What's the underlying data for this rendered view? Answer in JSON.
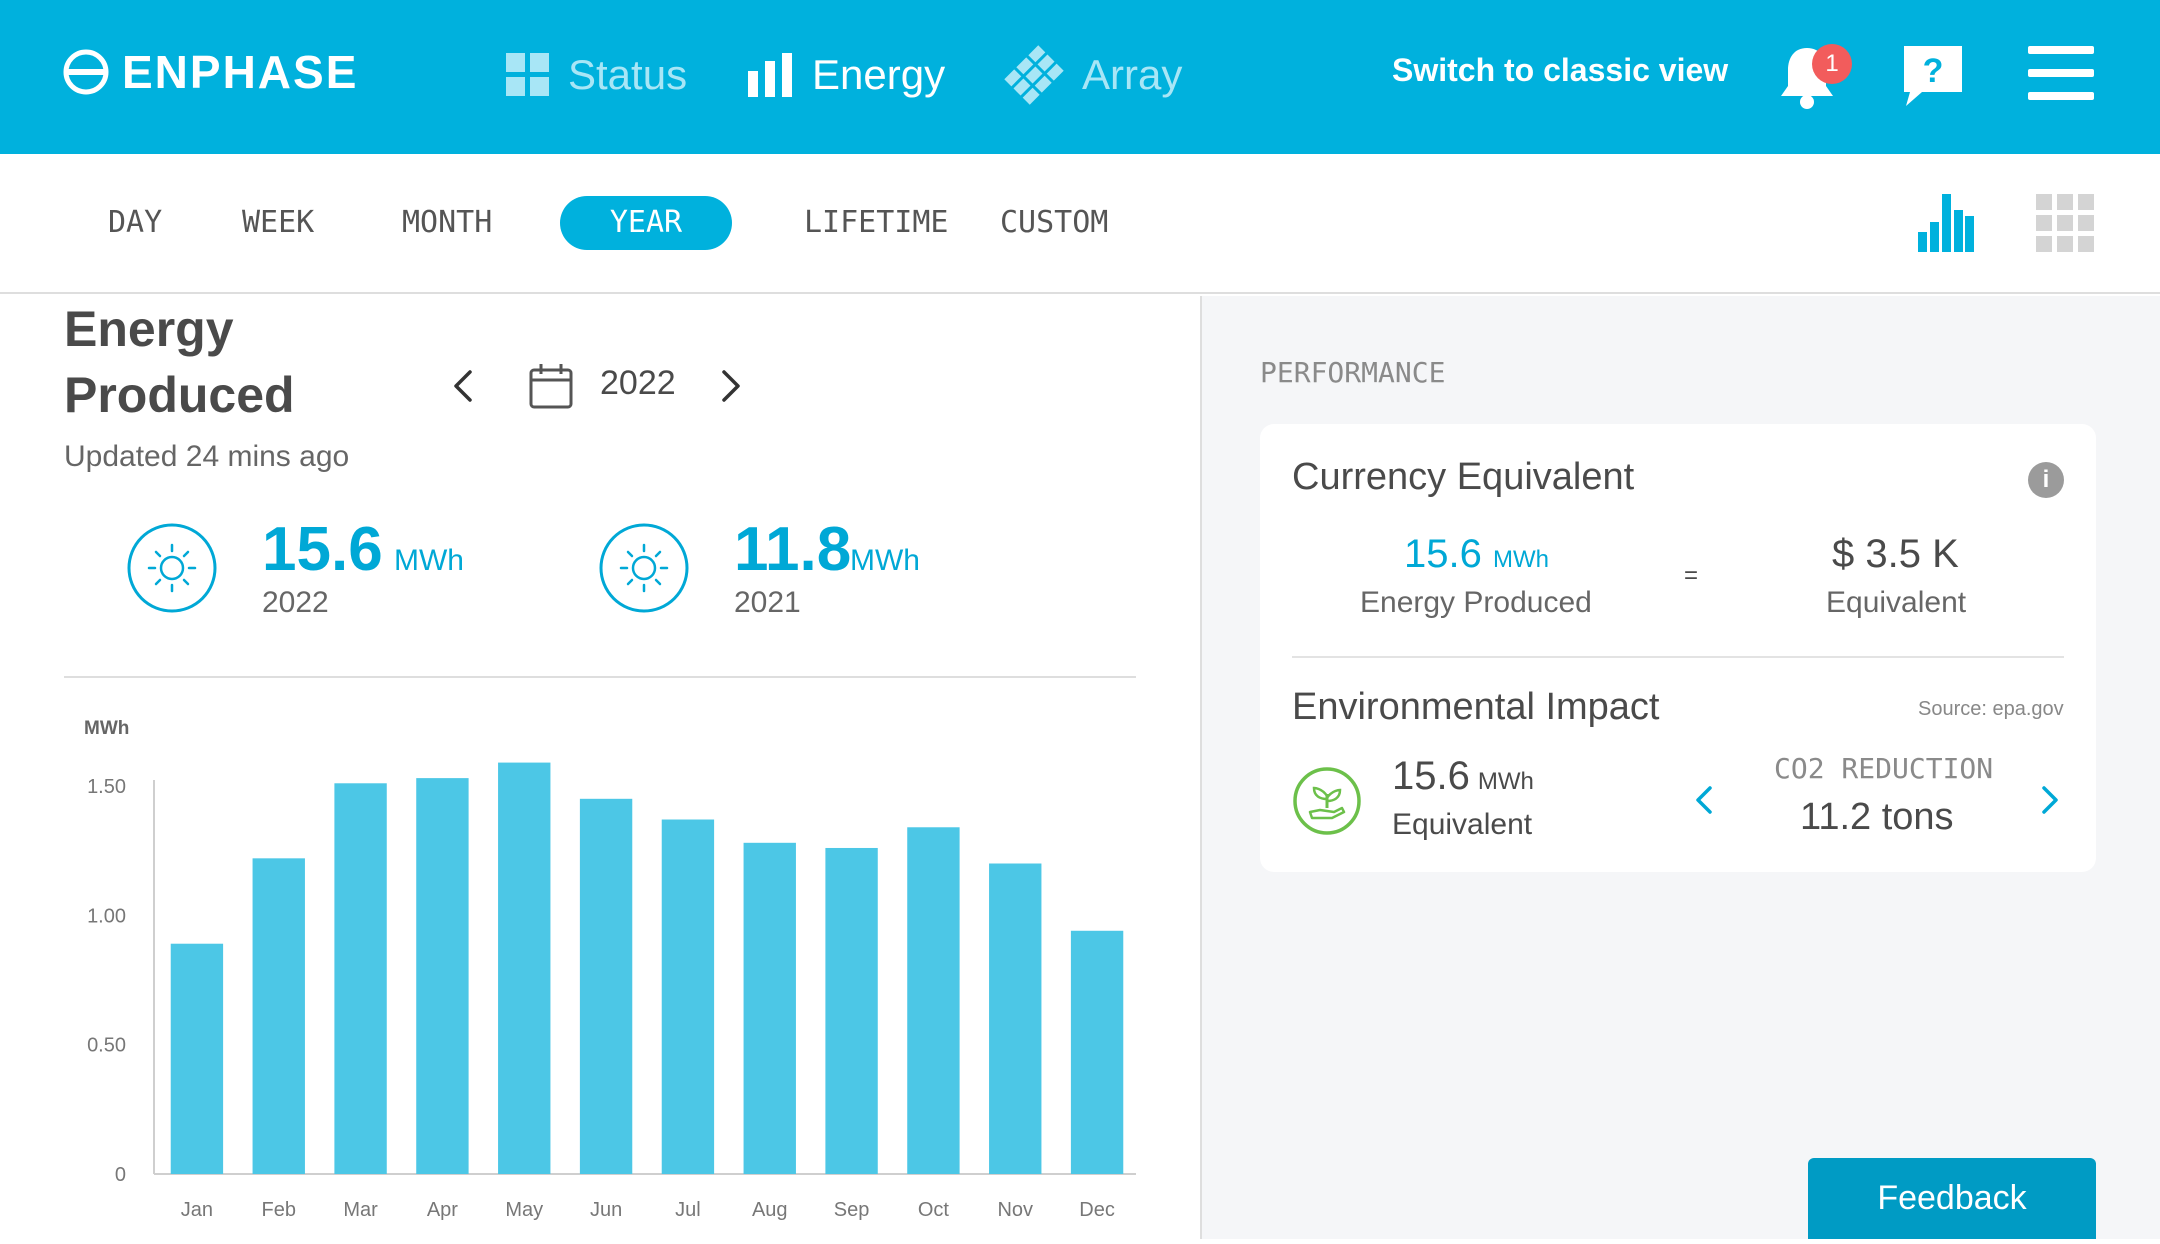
{
  "header": {
    "logo": "ENPHASE",
    "nav": [
      {
        "label": "Status",
        "icon": "grid-icon",
        "active": false
      },
      {
        "label": "Energy",
        "icon": "bar-chart-icon",
        "active": true
      },
      {
        "label": "Array",
        "icon": "array-icon",
        "active": false
      }
    ],
    "classic_view": "Switch to classic view",
    "notification_count": "1",
    "help_glyph": "?"
  },
  "tabs": [
    "DAY",
    "WEEK",
    "MONTH",
    "YEAR",
    "LIFETIME",
    "CUSTOM"
  ],
  "active_tab": "YEAR",
  "energy": {
    "title_line1": "Energy",
    "title_line2": "Produced",
    "year": "2022",
    "updated": "Updated 24 mins ago",
    "stats": [
      {
        "value": "15.6",
        "unit": "MWh",
        "year": "2022"
      },
      {
        "value": "11.8",
        "unit": "MWh",
        "year": "2021"
      }
    ]
  },
  "chart_data": {
    "type": "bar",
    "ylabel": "MWh",
    "categories": [
      "Jan",
      "Feb",
      "Mar",
      "Apr",
      "May",
      "Jun",
      "Jul",
      "Aug",
      "Sep",
      "Oct",
      "Nov",
      "Dec"
    ],
    "values": [
      0.89,
      1.22,
      1.51,
      1.53,
      1.59,
      1.45,
      1.37,
      1.28,
      1.26,
      1.34,
      1.2,
      0.94
    ],
    "yticks": [
      "0",
      "0.50",
      "1.00",
      "1.50"
    ],
    "ytick_values": [
      0,
      0.5,
      1.0,
      1.5
    ],
    "ylim": [
      0,
      1.6
    ],
    "color": "#4cc7e6"
  },
  "performance": {
    "heading": "PERFORMANCE",
    "currency": {
      "title": "Currency Equivalent",
      "energy_value": "15.6",
      "energy_unit": "MWh",
      "energy_label": "Energy Produced",
      "equals": "=",
      "money_value": "$ 3.5 K",
      "money_label": "Equivalent"
    },
    "environment": {
      "title": "Environmental Impact",
      "source": "Source: epa.gov",
      "value": "15.6",
      "unit": "MWh",
      "label": "Equivalent",
      "metric_label": "CO2 REDUCTION",
      "metric_value": "11.2 tons"
    }
  },
  "feedback": "Feedback",
  "colors": {
    "brand": "#00b1dd",
    "accent_text": "#00a8d6",
    "leaf": "#6cc04a",
    "badge": "#f25c5c"
  }
}
